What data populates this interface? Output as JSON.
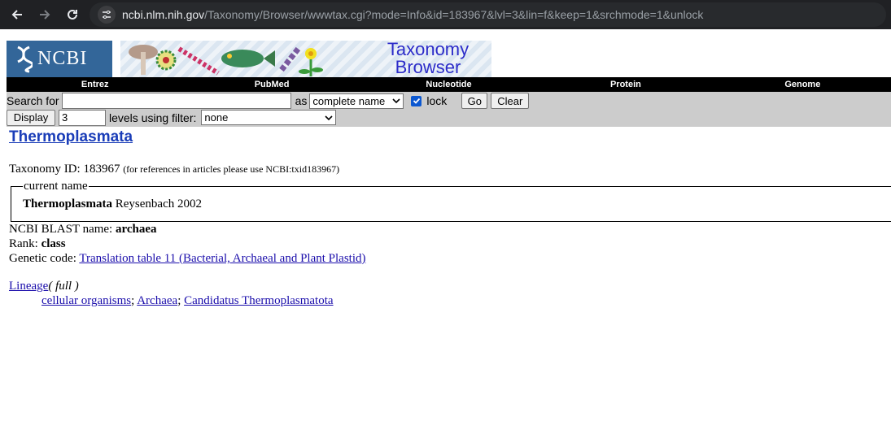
{
  "browser": {
    "url_host": "ncbi.nlm.nih.gov",
    "url_rest": "/Taxonomy/Browser/wwwtax.cgi?mode=Info&id=183967&lvl=3&lin=f&keep=1&srchmode=1&unlock"
  },
  "header": {
    "logo_text": "NCBI",
    "banner_title_line1": "Taxonomy",
    "banner_title_line2": "Browser"
  },
  "menu": [
    "Entrez",
    "PubMed",
    "Nucleotide",
    "Protein",
    "Genome"
  ],
  "search": {
    "search_for_label": "Search for",
    "search_value": "",
    "as_label": "as",
    "mode_selected": "complete name",
    "lock_label": "lock",
    "lock_checked": true,
    "go_label": "Go",
    "clear_label": "Clear",
    "display_label": "Display",
    "levels_value": "3",
    "levels_label": "levels using filter:",
    "filter_selected": "none"
  },
  "taxon": {
    "name": "Thermoplasmata",
    "taxid_label": "Taxonomy ID:",
    "taxid": "183967",
    "taxid_note": "(for references in articles please use NCBI:txid183967)",
    "current_name_legend": "current name",
    "current_name": "Thermoplasmata",
    "current_authority": "Reysenbach 2002",
    "blast_label": "NCBI BLAST name:",
    "blast_name": "archaea",
    "rank_label": "Rank:",
    "rank": "class",
    "genetic_code_label": "Genetic code:",
    "genetic_code": "Translation table 11 (Bacterial, Archaeal and Plant Plastid)",
    "lineage_label": "Lineage",
    "lineage_full": "( full )",
    "lineage": [
      "cellular organisms",
      "Archaea",
      "Candidatus Thermoplasmatota"
    ]
  }
}
